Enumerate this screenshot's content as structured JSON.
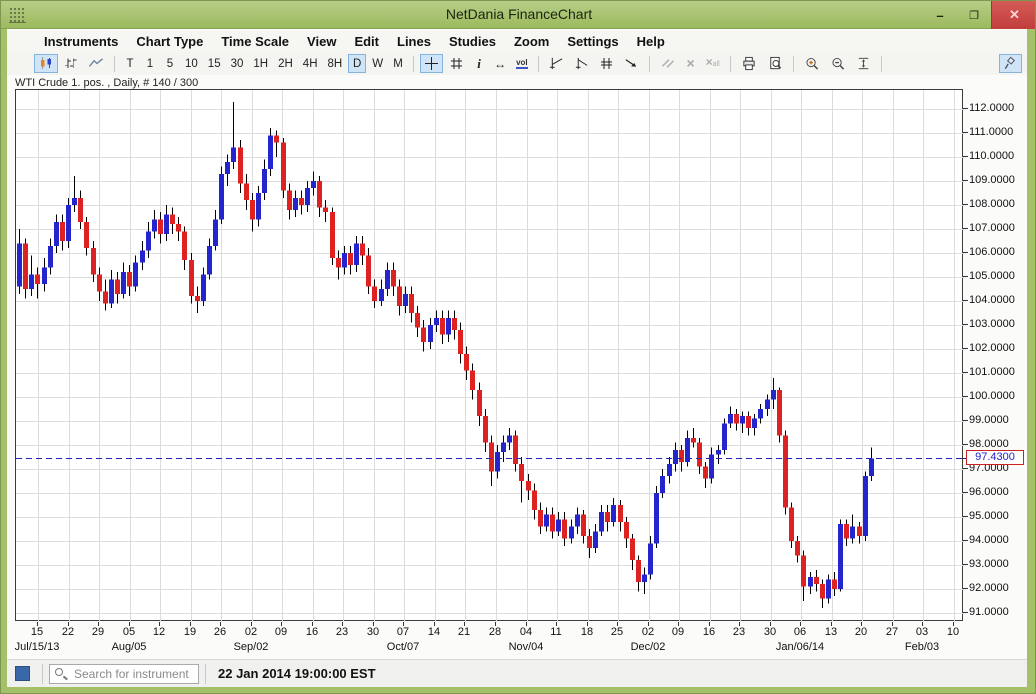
{
  "titlebar": {
    "title": "NetDania FinanceChart",
    "minimize_label": "–",
    "maximize_label": "❐",
    "close_label": "✕"
  },
  "menu_items": [
    "Instruments",
    "Chart Type",
    "Time Scale",
    "View",
    "Edit",
    "Lines",
    "Studies",
    "Zoom",
    "Settings",
    "Help"
  ],
  "toolbar": {
    "groups": [
      [
        {
          "name": "candlestick-chart",
          "icon": "candles",
          "selected": true
        },
        {
          "name": "bar-chart",
          "icon": "bars"
        },
        {
          "name": "line-chart",
          "icon": "line"
        }
      ],
      [
        {
          "name": "timescale-tick",
          "label": "T"
        },
        {
          "name": "timescale-1",
          "label": "1"
        },
        {
          "name": "timescale-5",
          "label": "5"
        },
        {
          "name": "timescale-10",
          "label": "10"
        },
        {
          "name": "timescale-15",
          "label": "15"
        },
        {
          "name": "timescale-30",
          "label": "30"
        },
        {
          "name": "timescale-1h",
          "label": "1H"
        },
        {
          "name": "timescale-2h",
          "label": "2H"
        },
        {
          "name": "timescale-4h",
          "label": "4H"
        },
        {
          "name": "timescale-8h",
          "label": "8H"
        },
        {
          "name": "timescale-daily",
          "label": "D",
          "selected": true
        },
        {
          "name": "timescale-weekly",
          "label": "W"
        },
        {
          "name": "timescale-monthly",
          "label": "M"
        }
      ],
      [
        {
          "name": "crosshair",
          "icon": "crosshair",
          "selected": true
        },
        {
          "name": "grid-toggle",
          "icon": "grid"
        },
        {
          "name": "info",
          "icon": "info"
        },
        {
          "name": "expand-horizontal",
          "icon": "expand"
        },
        {
          "name": "volume",
          "icon": "volume"
        }
      ],
      [
        {
          "name": "trend-line-up",
          "icon": "trend1"
        },
        {
          "name": "trend-line-down",
          "icon": "trend2"
        },
        {
          "name": "parallel-channel",
          "icon": "channel"
        },
        {
          "name": "ray-line",
          "icon": "ray"
        }
      ],
      [
        {
          "name": "parallel-lines",
          "icon": "parallel",
          "disabled": true
        },
        {
          "name": "delete-line",
          "icon": "delete",
          "disabled": true
        },
        {
          "name": "delete-all-lines",
          "icon": "delete-all",
          "disabled": true
        }
      ],
      [
        {
          "name": "print",
          "icon": "print"
        },
        {
          "name": "print-preview",
          "icon": "preview"
        }
      ],
      [
        {
          "name": "zoom-in",
          "icon": "zoom-in"
        },
        {
          "name": "zoom-out",
          "icon": "zoom-out"
        },
        {
          "name": "fit-vertical",
          "icon": "fit"
        }
      ]
    ],
    "pin_button": {
      "name": "pin-window",
      "icon": "pin",
      "selected": true
    }
  },
  "chart_header": {
    "instrument_label": "WTI Crude 1. pos. , Daily, # 140 / 300"
  },
  "chart_data": {
    "type": "candlestick",
    "instrument": "WTI Crude 1. pos.",
    "timeframe": "Daily",
    "bars_shown": "140 / 300",
    "current_price": 97.43,
    "current_price_label": "97.4300",
    "up_color": "#2525cd",
    "down_color": "#de2222",
    "wick_color": "#000000",
    "grid": true,
    "y_axis": {
      "min": 91,
      "max": 112,
      "step": 1,
      "tick_labels": [
        "112.0000",
        "111.0000",
        "110.0000",
        "109.0000",
        "108.0000",
        "107.0000",
        "106.0000",
        "105.0000",
        "104.0000",
        "103.0000",
        "102.0000",
        "101.0000",
        "100.0000",
        "99.0000",
        "98.0000",
        "97.0000",
        "96.0000",
        "95.0000",
        "94.0000",
        "93.0000",
        "92.0000",
        "91.0000"
      ]
    },
    "x_axis": {
      "week_ticks": [
        "15",
        "22",
        "29",
        "05",
        "12",
        "19",
        "26",
        "02",
        "09",
        "16",
        "23",
        "30",
        "07",
        "14",
        "21",
        "28",
        "04",
        "11",
        "18",
        "25",
        "02",
        "09",
        "16",
        "23",
        "30",
        "06",
        "13",
        "20",
        "27",
        "03",
        "10"
      ],
      "month_labels": [
        {
          "label": "Jul/15/13",
          "week": 0
        },
        {
          "label": "Aug/05",
          "week": 3
        },
        {
          "label": "Sep/02",
          "week": 7
        },
        {
          "label": "Oct/07",
          "week": 12
        },
        {
          "label": "Nov/04",
          "week": 16
        },
        {
          "label": "Dec/02",
          "week": 20
        },
        {
          "label": "Jan/06/14",
          "week": 25
        },
        {
          "label": "Feb/03",
          "week": 29
        }
      ]
    },
    "candles": [
      [
        104.6,
        107.0,
        104.3,
        106.4
      ],
      [
        106.4,
        106.6,
        104.1,
        104.5
      ],
      [
        104.5,
        105.9,
        104.2,
        105.1
      ],
      [
        105.1,
        105.4,
        104.1,
        104.7
      ],
      [
        104.7,
        105.8,
        104.4,
        105.4
      ],
      [
        105.4,
        106.6,
        105.1,
        106.3
      ],
      [
        106.3,
        107.6,
        106.0,
        107.3
      ],
      [
        107.3,
        107.6,
        106.1,
        106.5
      ],
      [
        106.5,
        108.3,
        106.2,
        108.0
      ],
      [
        108.0,
        109.2,
        107.7,
        108.3
      ],
      [
        108.3,
        108.6,
        107.0,
        107.3
      ],
      [
        107.3,
        107.5,
        105.9,
        106.2
      ],
      [
        106.2,
        106.5,
        104.8,
        105.1
      ],
      [
        105.1,
        105.4,
        104.0,
        104.4
      ],
      [
        104.4,
        104.9,
        103.6,
        103.9
      ],
      [
        103.9,
        105.3,
        103.7,
        104.9
      ],
      [
        104.9,
        105.2,
        103.9,
        104.3
      ],
      [
        104.3,
        105.6,
        104.1,
        105.2
      ],
      [
        105.2,
        105.5,
        104.2,
        104.6
      ],
      [
        104.6,
        105.9,
        104.4,
        105.6
      ],
      [
        105.6,
        106.5,
        105.3,
        106.1
      ],
      [
        106.1,
        107.3,
        105.8,
        106.9
      ],
      [
        106.9,
        107.8,
        106.6,
        107.4
      ],
      [
        107.4,
        107.7,
        106.4,
        106.8
      ],
      [
        106.8,
        108.0,
        106.5,
        107.6
      ],
      [
        107.6,
        107.9,
        106.8,
        107.2
      ],
      [
        107.2,
        107.5,
        106.5,
        106.9
      ],
      [
        106.9,
        107.1,
        105.3,
        105.7
      ],
      [
        105.7,
        106.0,
        103.9,
        104.2
      ],
      [
        104.2,
        104.6,
        103.5,
        104.0
      ],
      [
        104.0,
        105.4,
        103.8,
        105.1
      ],
      [
        105.1,
        106.6,
        104.9,
        106.3
      ],
      [
        106.3,
        107.8,
        106.1,
        107.4
      ],
      [
        107.4,
        109.6,
        107.2,
        109.3
      ],
      [
        109.3,
        110.1,
        108.8,
        109.8
      ],
      [
        109.8,
        112.3,
        109.5,
        110.4
      ],
      [
        110.4,
        110.7,
        108.5,
        108.9
      ],
      [
        108.9,
        109.3,
        107.8,
        108.2
      ],
      [
        108.2,
        108.5,
        106.9,
        107.4
      ],
      [
        107.4,
        108.8,
        107.1,
        108.5
      ],
      [
        108.5,
        109.9,
        108.2,
        109.5
      ],
      [
        109.5,
        111.2,
        109.2,
        110.9
      ],
      [
        110.9,
        111.1,
        110.0,
        110.6
      ],
      [
        110.6,
        110.8,
        108.3,
        108.6
      ],
      [
        108.6,
        108.9,
        107.4,
        107.8
      ],
      [
        107.8,
        108.6,
        107.5,
        108.3
      ],
      [
        108.3,
        108.6,
        107.6,
        108.0
      ],
      [
        108.0,
        109.0,
        107.7,
        108.7
      ],
      [
        108.7,
        109.4,
        108.4,
        109.0
      ],
      [
        109.0,
        109.2,
        107.5,
        107.9
      ],
      [
        107.9,
        108.2,
        107.3,
        107.7
      ],
      [
        107.7,
        107.9,
        105.5,
        105.8
      ],
      [
        105.8,
        106.1,
        104.9,
        105.4
      ],
      [
        105.4,
        106.3,
        105.1,
        106.0
      ],
      [
        106.0,
        106.3,
        105.1,
        105.5
      ],
      [
        105.5,
        106.7,
        105.2,
        106.4
      ],
      [
        106.4,
        106.7,
        105.5,
        105.9
      ],
      [
        105.9,
        106.2,
        104.3,
        104.6
      ],
      [
        104.6,
        104.9,
        103.7,
        104.0
      ],
      [
        104.0,
        104.9,
        103.8,
        104.5
      ],
      [
        104.5,
        105.6,
        104.2,
        105.3
      ],
      [
        105.3,
        105.6,
        104.2,
        104.6
      ],
      [
        104.6,
        104.9,
        103.4,
        103.8
      ],
      [
        103.8,
        104.6,
        103.5,
        104.3
      ],
      [
        104.3,
        104.6,
        103.1,
        103.5
      ],
      [
        103.5,
        103.8,
        102.5,
        102.9
      ],
      [
        102.9,
        103.2,
        101.9,
        102.3
      ],
      [
        102.3,
        103.3,
        102.0,
        103.0
      ],
      [
        103.0,
        103.6,
        102.7,
        103.3
      ],
      [
        103.3,
        103.6,
        102.2,
        102.6
      ],
      [
        102.6,
        103.6,
        102.3,
        103.3
      ],
      [
        103.3,
        103.6,
        102.4,
        102.8
      ],
      [
        102.8,
        103.1,
        101.4,
        101.8
      ],
      [
        101.8,
        102.1,
        100.7,
        101.1
      ],
      [
        101.1,
        101.4,
        99.9,
        100.3
      ],
      [
        100.3,
        100.6,
        98.8,
        99.2
      ],
      [
        99.2,
        99.5,
        97.7,
        98.1
      ],
      [
        98.1,
        98.4,
        96.3,
        96.9
      ],
      [
        96.9,
        98.0,
        96.6,
        97.7
      ],
      [
        97.7,
        98.4,
        97.3,
        98.1
      ],
      [
        98.1,
        98.7,
        97.8,
        98.4
      ],
      [
        98.4,
        98.6,
        96.9,
        97.2
      ],
      [
        97.2,
        97.5,
        95.6,
        96.5
      ],
      [
        96.5,
        96.8,
        95.7,
        96.1
      ],
      [
        96.1,
        96.4,
        94.9,
        95.3
      ],
      [
        95.3,
        95.6,
        94.3,
        94.6
      ],
      [
        94.6,
        95.4,
        94.4,
        95.1
      ],
      [
        95.1,
        95.4,
        94.1,
        94.4
      ],
      [
        94.4,
        95.2,
        94.2,
        94.9
      ],
      [
        94.9,
        95.2,
        93.8,
        94.1
      ],
      [
        94.1,
        94.9,
        93.9,
        94.6
      ],
      [
        94.6,
        95.4,
        94.3,
        95.1
      ],
      [
        95.1,
        95.3,
        93.9,
        94.2
      ],
      [
        94.2,
        94.5,
        93.3,
        93.7
      ],
      [
        93.7,
        94.7,
        93.5,
        94.4
      ],
      [
        94.4,
        95.5,
        94.2,
        95.2
      ],
      [
        95.2,
        95.5,
        94.4,
        94.8
      ],
      [
        94.8,
        95.8,
        94.6,
        95.5
      ],
      [
        95.5,
        95.7,
        94.4,
        94.8
      ],
      [
        94.8,
        95.0,
        93.7,
        94.1
      ],
      [
        94.1,
        94.3,
        92.8,
        93.2
      ],
      [
        93.2,
        93.4,
        91.9,
        92.3
      ],
      [
        92.3,
        92.9,
        91.8,
        92.6
      ],
      [
        92.6,
        94.2,
        92.4,
        93.9
      ],
      [
        93.9,
        96.3,
        93.7,
        96.0
      ],
      [
        96.0,
        97.0,
        95.8,
        96.7
      ],
      [
        96.7,
        97.5,
        96.4,
        97.2
      ],
      [
        97.2,
        98.1,
        96.9,
        97.8
      ],
      [
        97.8,
        98.0,
        96.9,
        97.3
      ],
      [
        97.3,
        98.6,
        97.1,
        98.3
      ],
      [
        98.3,
        98.7,
        97.9,
        98.1
      ],
      [
        98.1,
        98.3,
        96.8,
        97.1
      ],
      [
        97.1,
        97.3,
        96.2,
        96.6
      ],
      [
        96.6,
        97.9,
        96.4,
        97.6
      ],
      [
        97.6,
        98.0,
        97.2,
        97.8
      ],
      [
        97.8,
        99.1,
        97.6,
        98.9
      ],
      [
        98.9,
        99.6,
        98.7,
        99.3
      ],
      [
        99.3,
        99.5,
        98.6,
        98.9
      ],
      [
        98.9,
        99.4,
        98.5,
        99.2
      ],
      [
        99.2,
        99.4,
        98.4,
        98.7
      ],
      [
        98.7,
        99.3,
        98.4,
        99.1
      ],
      [
        99.1,
        99.7,
        98.9,
        99.5
      ],
      [
        99.5,
        100.1,
        99.2,
        99.9
      ],
      [
        99.9,
        100.8,
        99.5,
        100.3
      ],
      [
        100.3,
        100.4,
        98.1,
        98.4
      ],
      [
        98.4,
        98.6,
        95.1,
        95.4
      ],
      [
        95.4,
        95.6,
        93.7,
        94.0
      ],
      [
        94.0,
        94.2,
        93.1,
        93.4
      ],
      [
        93.4,
        93.6,
        91.5,
        92.1
      ],
      [
        92.1,
        92.7,
        91.8,
        92.5
      ],
      [
        92.5,
        92.8,
        91.9,
        92.2
      ],
      [
        92.2,
        92.4,
        91.2,
        91.6
      ],
      [
        91.6,
        92.6,
        91.4,
        92.4
      ],
      [
        92.4,
        92.7,
        91.7,
        92.0
      ],
      [
        92.0,
        94.9,
        91.9,
        94.7
      ],
      [
        94.7,
        94.9,
        93.8,
        94.1
      ],
      [
        94.1,
        95.1,
        93.9,
        94.6
      ],
      [
        94.6,
        94.8,
        93.9,
        94.2
      ],
      [
        94.2,
        96.9,
        94.0,
        96.7
      ],
      [
        96.7,
        97.9,
        96.5,
        97.43
      ]
    ]
  },
  "statusbar": {
    "search_placeholder": "Search for instrument",
    "timestamp": "22 Jan 2014 19:00:00 EST"
  }
}
